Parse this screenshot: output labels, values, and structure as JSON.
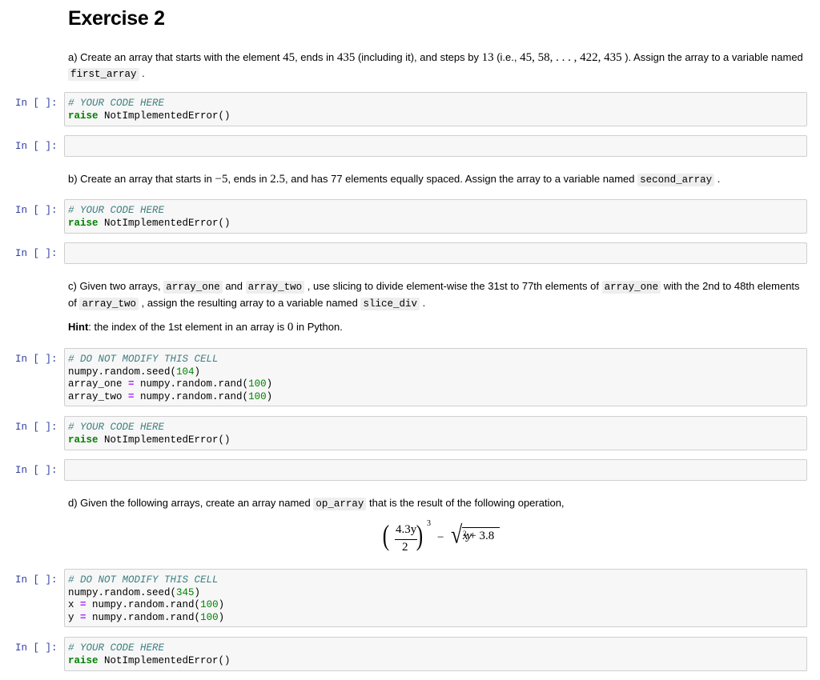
{
  "title": "Exercise 2",
  "prompt_label": "In [ ]:",
  "part_a": {
    "text_1": "a) Create an array that starts with the element ",
    "math_1": "45",
    "text_2": ", ends in ",
    "math_2": "435",
    "text_3": " (including it), and steps by ",
    "math_3": "13",
    "text_4": " (i.e., ",
    "math_4": "45, 58, . . . , 422, 435",
    "text_5": " ). Assign the array to a variable named ",
    "code_1": "first_array",
    "text_6": " ."
  },
  "part_b": {
    "text_1": "b) Create an array that starts in ",
    "math_1": "−5",
    "text_2": ", ends in ",
    "math_2": "2.5",
    "text_3": ", and has 77 elements equally spaced. Assign the array to a variable named ",
    "code_1": "second_array",
    "text_4": " ."
  },
  "part_c": {
    "text_1": "c) Given two arrays, ",
    "code_1": "array_one",
    "text_2": " and ",
    "code_2": "array_two",
    "text_3": " , use slicing to divide element-wise the 31st to 77th elements of ",
    "code_3": "array_one",
    "text_4": " with the 2nd to 48th elements of ",
    "code_4": "array_two",
    "text_5": " , assign the resulting array to a variable named ",
    "code_5": "slice_div",
    "text_6": " .",
    "hint_label": "Hint",
    "hint_text_1": ": the index of the 1st element in an array is ",
    "hint_math": "0",
    "hint_text_2": " in Python."
  },
  "part_d": {
    "text_1": "d) Given the following arrays, create an array named ",
    "code_1": "op_array",
    "text_2": " that is the result of the following operation,",
    "formula": {
      "numerator": "4.3y",
      "denominator": "2",
      "exponent": "3",
      "minus": "−",
      "radicand_var": "x",
      "radicand_exp": "2",
      "radicand_rest": " + 3.8",
      "radicand_var2": "y"
    }
  },
  "cells": {
    "your_code_comment": "# YOUR CODE HERE",
    "raise_kw": "raise",
    "raise_rest": " NotImplementedError()",
    "do_not_modify_comment": "# DO NOT MODIFY THIS CELL",
    "c_setup": {
      "seed_pre": "numpy.random.seed(",
      "seed_val": "104",
      "seed_post": ")",
      "var1": "array_one ",
      "var2": "array_two ",
      "eq": "=",
      "rand_pre": " numpy.random.rand(",
      "rand_val": "100",
      "rand_post": ")"
    },
    "d_setup": {
      "seed_pre": "numpy.random.seed(",
      "seed_val": "345",
      "seed_post": ")",
      "var1": "x ",
      "var2": "y ",
      "eq": "=",
      "rand_pre": " numpy.random.rand(",
      "rand_val": "100",
      "rand_post": ")"
    }
  }
}
